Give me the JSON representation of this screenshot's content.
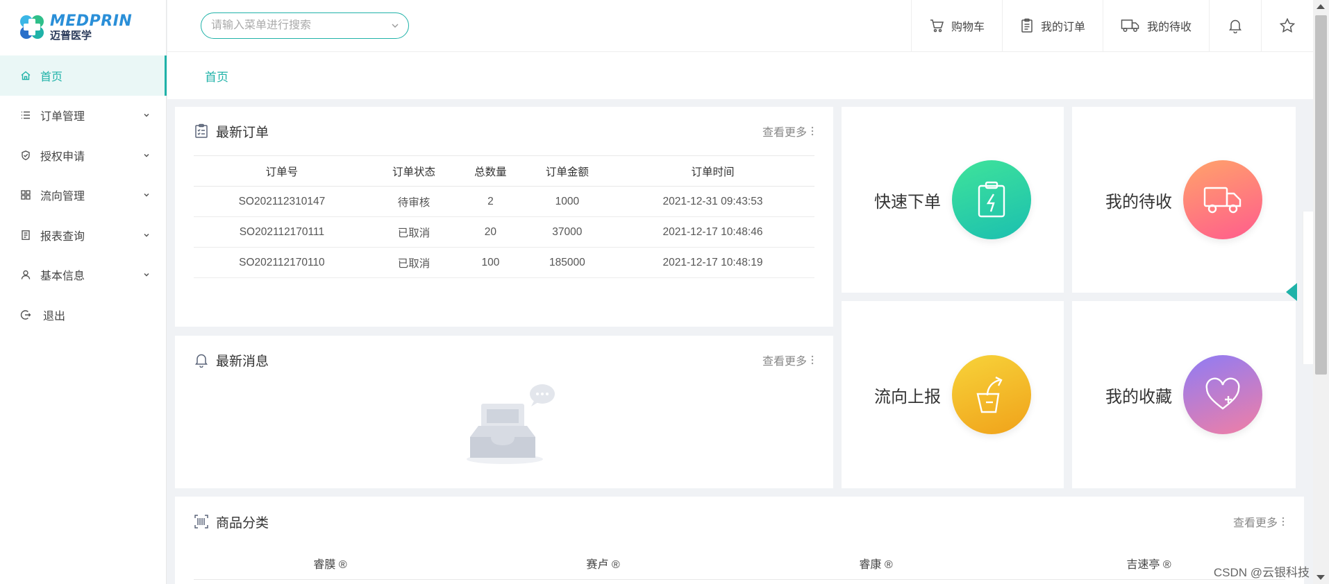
{
  "app": {
    "logo_en": "MEDPRIN",
    "logo_cn": "迈普医学"
  },
  "sidebar": {
    "items": [
      {
        "label": "首页",
        "icon": "home-icon",
        "active": true,
        "has_children": false
      },
      {
        "label": "订单管理",
        "icon": "list-icon",
        "active": false,
        "has_children": true
      },
      {
        "label": "授权申请",
        "icon": "shield-check-icon",
        "active": false,
        "has_children": true
      },
      {
        "label": "流向管理",
        "icon": "grid-icon",
        "active": false,
        "has_children": true
      },
      {
        "label": "报表查询",
        "icon": "report-icon",
        "active": false,
        "has_children": true
      },
      {
        "label": "基本信息",
        "icon": "user-icon",
        "active": false,
        "has_children": true
      },
      {
        "label": "退出",
        "icon": "logout-icon",
        "active": false,
        "has_children": false
      }
    ]
  },
  "header": {
    "search_placeholder": "请输入菜单进行搜索",
    "cart_label": "购物车",
    "orders_label": "我的订单",
    "pending_label": "我的待收"
  },
  "breadcrumb": {
    "current": "首页"
  },
  "latest_orders": {
    "title": "最新订单",
    "more": "查看更多",
    "columns": [
      "订单号",
      "订单状态",
      "总数量",
      "订单金额",
      "订单时间"
    ],
    "rows": [
      [
        "SO202112310147",
        "待审核",
        "2",
        "1000",
        "2021-12-31 09:43:53"
      ],
      [
        "SO202112170111",
        "已取消",
        "20",
        "37000",
        "2021-12-17 10:48:46"
      ],
      [
        "SO202112170110",
        "已取消",
        "100",
        "185000",
        "2021-12-17 10:48:19"
      ]
    ]
  },
  "latest_messages": {
    "title": "最新消息",
    "more": "查看更多"
  },
  "quick_actions": {
    "quick_order": "快速下单",
    "my_pending": "我的待收",
    "flow_report": "流向上报",
    "my_favorites": "我的收藏"
  },
  "categories": {
    "title": "商品分类",
    "more": "查看更多",
    "items": [
      "睿膜 ®",
      "赛卢 ®",
      "睿康 ®",
      "吉速亭 ®"
    ]
  },
  "watermark": "CSDN @云银科技",
  "colors": {
    "accent": "#1fb2a8",
    "green_from": "#3fe39a",
    "green_to": "#1bbfb0",
    "pink_from": "#ffa36a",
    "pink_to": "#ff5c8d",
    "yellow_from": "#f7d33a",
    "yellow_to": "#f0a21a",
    "purple_from": "#8e7cf5",
    "purple_to": "#f17ea4"
  }
}
